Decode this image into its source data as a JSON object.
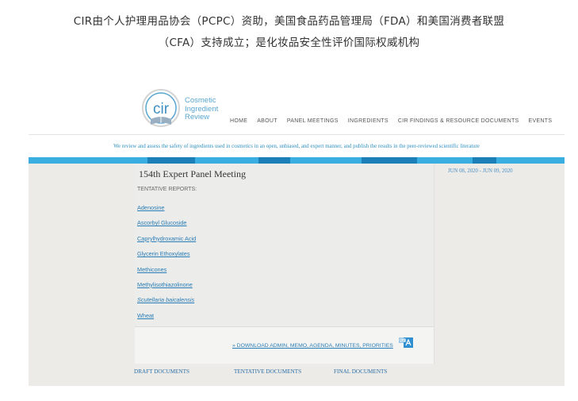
{
  "caption": {
    "line1": "CIR由个人护理用品协会（PCPC）资助，美国食品药品管理局（FDA）和美国消费者联盟",
    "line2": "（CFA）支持成立；是化妆品安全性评价国际权威机构"
  },
  "site": {
    "logo_text": "cir",
    "brand_lines": [
      "Cosmetic",
      "Ingredient",
      "Review"
    ],
    "nav": [
      "HOME",
      "ABOUT",
      "PANEL MEETINGS",
      "INGREDIENTS",
      "CIR FINDINGS & RESOURCE DOCUMENTS",
      "EVENTS"
    ],
    "tagline": "We review and assess the safety of ingredients used in cosmetics in an open, unbiased, and expert manner, and publish the results in the peer-reviewed scientific literature"
  },
  "meeting": {
    "title": "154th Expert Panel Meeting",
    "section_label": "TENTATIVE REPORTS:",
    "reports": [
      {
        "label": "Adenosine",
        "italic": false
      },
      {
        "label": "Ascorbyl Glucoside",
        "italic": false
      },
      {
        "label": "Caprylhydroxamic Acid",
        "italic": false
      },
      {
        "label": "Glycerin Ethoxylates",
        "italic": false
      },
      {
        "label": "Methicones",
        "italic": false
      },
      {
        "label": "Methylisothiazolinone",
        "italic": false
      },
      {
        "label": "Scutellaria baicalensis",
        "italic": true
      },
      {
        "label": "Wheat",
        "italic": false
      }
    ],
    "download_link": "» DOWNLOAD ADMIN, MEMO, AGENDA, MINUTES, PRIORITIES",
    "date_range": "JUN 08, 2020 - JUN 09, 2020"
  },
  "bottom_links": [
    "DRAFT DOCUMENTS",
    "TENTATIVE DOCUMENTS",
    "FINAL DOCUMENTS"
  ],
  "colors": {
    "accent": "#3aaee0",
    "link": "#2a7db6",
    "brand": "#5aa6cf"
  },
  "icons": {
    "pdf": "pdf-icon"
  }
}
